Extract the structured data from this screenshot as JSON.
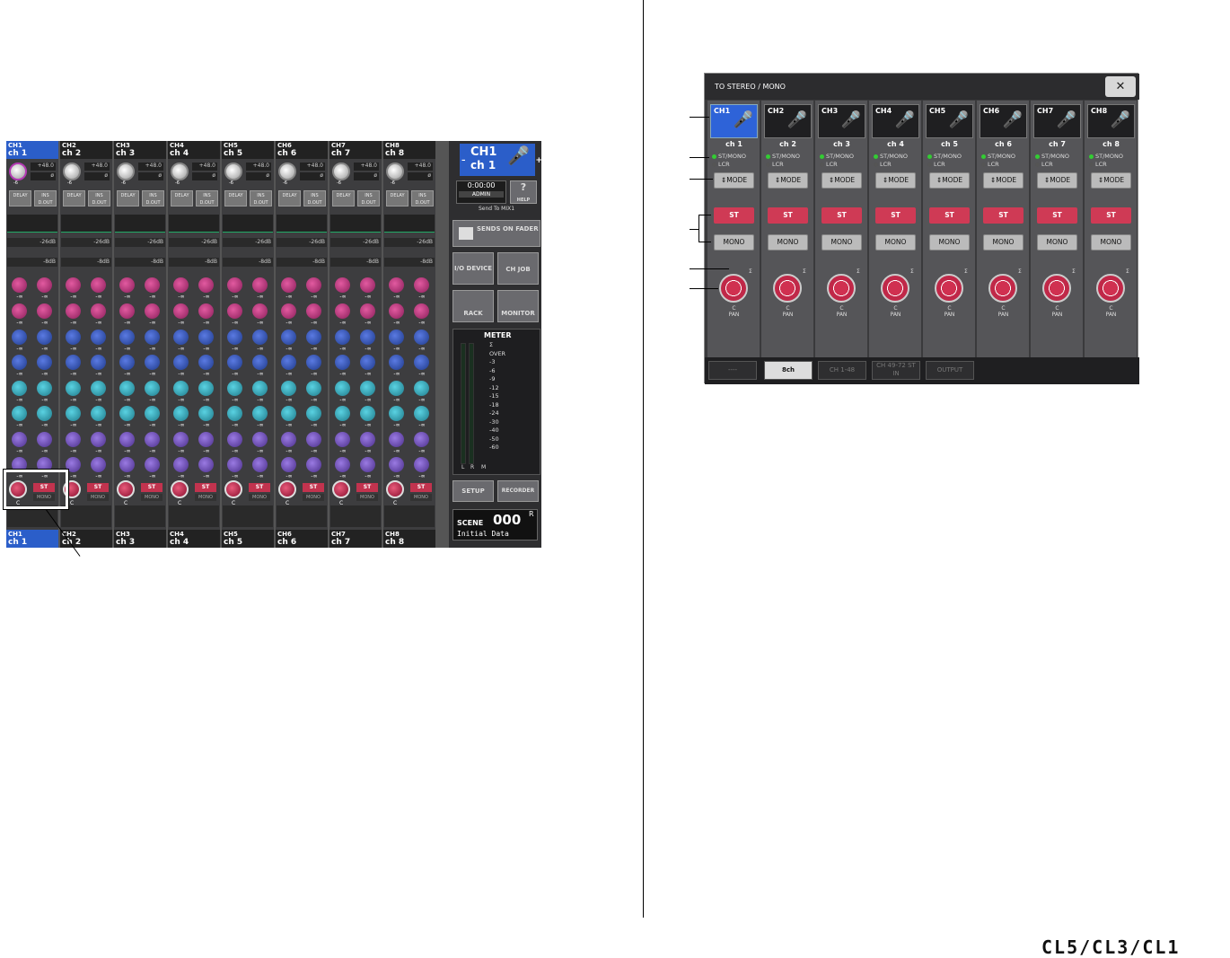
{
  "overview": {
    "strips": [
      {
        "id": "CH1",
        "name": "ch 1",
        "selected": true
      },
      {
        "id": "CH2",
        "name": "ch 2",
        "selected": false
      },
      {
        "id": "CH3",
        "name": "ch 3",
        "selected": false
      },
      {
        "id": "CH4",
        "name": "ch 4",
        "selected": false
      },
      {
        "id": "CH5",
        "name": "ch 5",
        "selected": false
      },
      {
        "id": "CH6",
        "name": "ch 6",
        "selected": false
      },
      {
        "id": "CH7",
        "name": "ch 7",
        "selected": false
      },
      {
        "id": "CH8",
        "name": "ch 8",
        "selected": false
      }
    ],
    "gain_value": "+48.0",
    "gain_phase": "ø",
    "gain_knob_label": "-6",
    "delay_label": "DELAY",
    "ins_label": "INS",
    "dout_label": "D.OUT",
    "dyn1": "-26dB",
    "dyn2": "-8dB",
    "send_value": "-∞",
    "st_label": "ST",
    "mono_label": "MONO",
    "pan_center": "C",
    "right": {
      "selected_id": "CH1",
      "selected_name": "ch  1",
      "minus": "–",
      "plus": "+",
      "time": "0:00:00",
      "user": "ADMIN",
      "help": "HELP",
      "send_to": "Send To MIX1",
      "sends_on_fader": "SENDS ON FADER",
      "io_device": "I/O DEVICE",
      "ch_job": "CH JOB",
      "rack": "RACK",
      "monitor": "MONITOR",
      "meter_title": "METER",
      "meter_scale": [
        "Σ",
        "OVER",
        "-3",
        "-6",
        "-9",
        "-12",
        "-15",
        "-18",
        "-24",
        "-30",
        "-40",
        "-50",
        "-60"
      ],
      "meter_l": "L",
      "meter_r": "R",
      "meter_m": "M",
      "setup": "SETUP",
      "recorder": "RECORDER",
      "scene_label": "SCENE",
      "scene_number": "000",
      "scene_flag": "R",
      "scene_name": "Initial Data"
    }
  },
  "popup": {
    "title": "TO STEREO / MONO",
    "close_icon": "close-icon",
    "channels": [
      {
        "id": "CH1",
        "name": "ch 1",
        "selected": true
      },
      {
        "id": "CH2",
        "name": "ch 2",
        "selected": false
      },
      {
        "id": "CH3",
        "name": "ch 3",
        "selected": false
      },
      {
        "id": "CH4",
        "name": "ch 4",
        "selected": false
      },
      {
        "id": "CH5",
        "name": "ch 5",
        "selected": false
      },
      {
        "id": "CH6",
        "name": "ch 6",
        "selected": false
      },
      {
        "id": "CH7",
        "name": "ch 7",
        "selected": false
      },
      {
        "id": "CH8",
        "name": "ch 8",
        "selected": false
      }
    ],
    "mode_st_mono": "ST/MONO",
    "mode_lcr": "LCR",
    "mode_button": "MODE",
    "st_button": "ST",
    "mono_button": "MONO",
    "pan_value": "C",
    "pan_label": "PAN",
    "pan_indicator": "Σ",
    "tabs": [
      {
        "label": "----",
        "selected": false
      },
      {
        "label": "8ch",
        "selected": true
      },
      {
        "label": "CH 1-48",
        "selected": false
      },
      {
        "label": "CH 49-72 ST IN",
        "selected": false
      },
      {
        "label": "OUTPUT",
        "selected": false
      }
    ]
  },
  "brand": "CL5/CL3/CL1"
}
